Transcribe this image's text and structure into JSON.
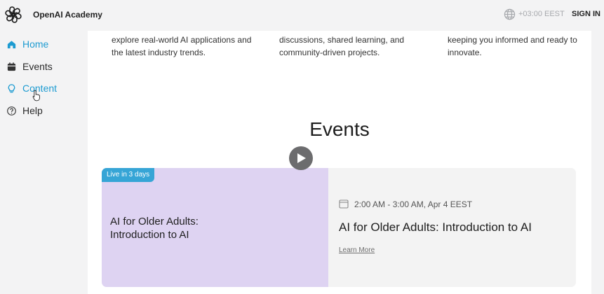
{
  "header": {
    "brand": "OpenAI Academy",
    "timezone": "+03:00 EEST",
    "sign_in": "SIGN IN"
  },
  "sidebar": {
    "items": [
      {
        "label": "Home",
        "icon": "home-icon",
        "active": true
      },
      {
        "label": "Events",
        "icon": "calendar-icon",
        "active": false
      },
      {
        "label": "Content",
        "icon": "lightbulb-icon",
        "active": true
      },
      {
        "label": "Help",
        "icon": "help-icon",
        "active": false
      }
    ]
  },
  "intro": {
    "col1": "explore real-world AI applications and the latest industry trends.",
    "col2": "discussions, shared learning, and community-driven projects.",
    "col3": "keeping you informed and ready to innovate."
  },
  "events": {
    "title": "Events",
    "card": {
      "badge": "Live in 3 days",
      "left_title": "AI for Older Adults: Introduction to AI",
      "date": "2:00 AM - 3:00 AM, Apr 4 EEST",
      "title": "AI for Older Adults: Introduction to AI",
      "learn_more": "Learn More"
    }
  },
  "colors": {
    "accent": "#1d9bd1",
    "badge": "#36a5d6",
    "card_left_bg": "#ded3f2",
    "card_right_bg": "#f3f3f3"
  }
}
